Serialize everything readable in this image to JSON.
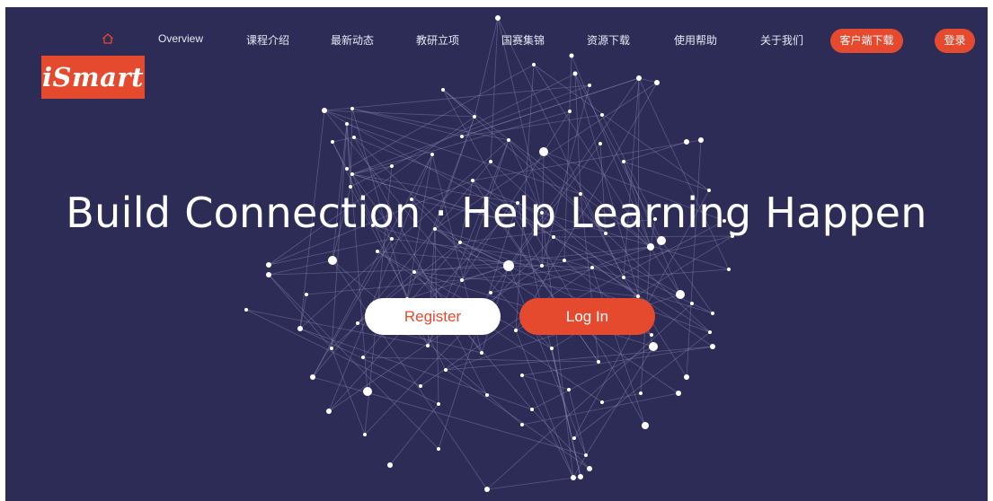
{
  "brand": {
    "logo_text": "iSmart",
    "accent_color": "#e64a2e",
    "background_color": "#2d2c57"
  },
  "nav": {
    "home_icon": "home-icon",
    "items": [
      "Overview",
      "课程介绍",
      "最新动态",
      "教研立项",
      "国赛集锦",
      "资源下载",
      "使用帮助",
      "关于我们"
    ],
    "download_button": "客户端下载",
    "login_button": "登录"
  },
  "hero": {
    "headline": "Build Connection · Help Learning Happen",
    "register_button": "Register",
    "login_button": "Log In"
  }
}
